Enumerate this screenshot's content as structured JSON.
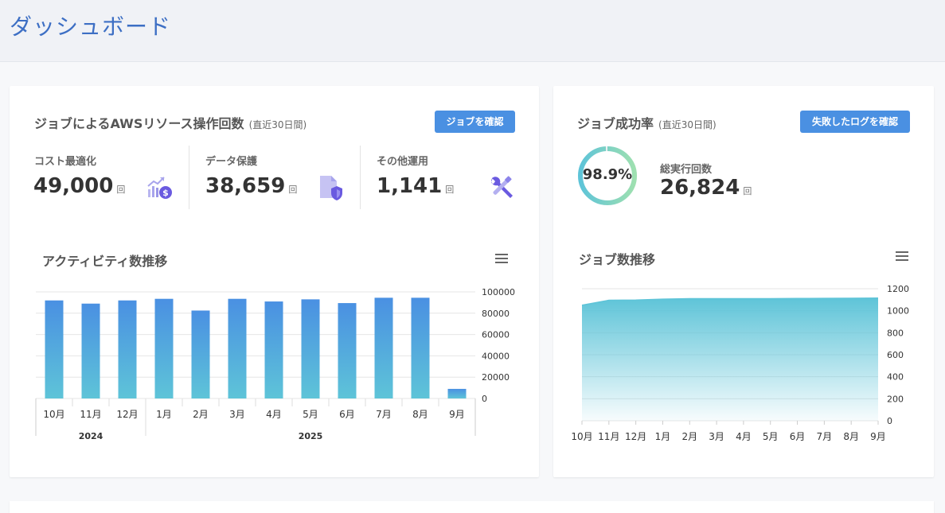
{
  "header": {
    "title": "ダッシュボード"
  },
  "aws_card": {
    "title": "ジョブによるAWSリソース操作回数",
    "subtitle": "(直近30日間)",
    "button": "ジョブを確認",
    "stats": [
      {
        "label": "コスト最適化",
        "value": "49,000",
        "unit": "回",
        "icon": "cost-chart-icon"
      },
      {
        "label": "データ保護",
        "value": "38,659",
        "unit": "回",
        "icon": "data-protection-icon"
      },
      {
        "label": "その他運用",
        "value": "1,141",
        "unit": "回",
        "icon": "tools-icon"
      }
    ],
    "chart_title": "アクティビティ数推移"
  },
  "success_card": {
    "title": "ジョブ成功率",
    "subtitle": "(直近30日間)",
    "button": "失敗したログを確認",
    "rate": "98.9%",
    "rate_fraction": 0.989,
    "total_label": "総実行回数",
    "total_value": "26,824",
    "unit": "回",
    "chart_title": "ジョブ数推移"
  },
  "colors": {
    "accent": "#4a90e2",
    "bar_top": "#4a90e2",
    "bar_bottom": "#5ec4d8",
    "ring": "#5ec4d8"
  },
  "chart_data": [
    {
      "type": "bar",
      "categories": [
        "10月",
        "11月",
        "12月",
        "1月",
        "2月",
        "3月",
        "4月",
        "5月",
        "6月",
        "7月",
        "8月",
        "9月"
      ],
      "groups": [
        {
          "label": "2024",
          "count": 3
        },
        {
          "label": "2025",
          "count": 9
        }
      ],
      "values": [
        92000,
        89000,
        92000,
        93500,
        82500,
        93500,
        91000,
        93000,
        89500,
        94500,
        94500,
        9000
      ],
      "ylim": [
        0,
        100000
      ],
      "yticks": [
        "0",
        "20000",
        "40000",
        "60000",
        "80000",
        "100000"
      ],
      "y_axis_position": "right",
      "grid": true
    },
    {
      "type": "area",
      "categories": [
        "10月",
        "11月",
        "12月",
        "1月",
        "2月",
        "3月",
        "4月",
        "5月",
        "6月",
        "7月",
        "8月",
        "9月"
      ],
      "values": [
        1050,
        1095,
        1097,
        1105,
        1110,
        1110,
        1110,
        1110,
        1111,
        1112,
        1113,
        1115
      ],
      "ylim": [
        0,
        1200
      ],
      "yticks": [
        "0",
        "200",
        "400",
        "600",
        "800",
        "1000",
        "1200"
      ],
      "y_axis_position": "right",
      "grid": true
    }
  ]
}
